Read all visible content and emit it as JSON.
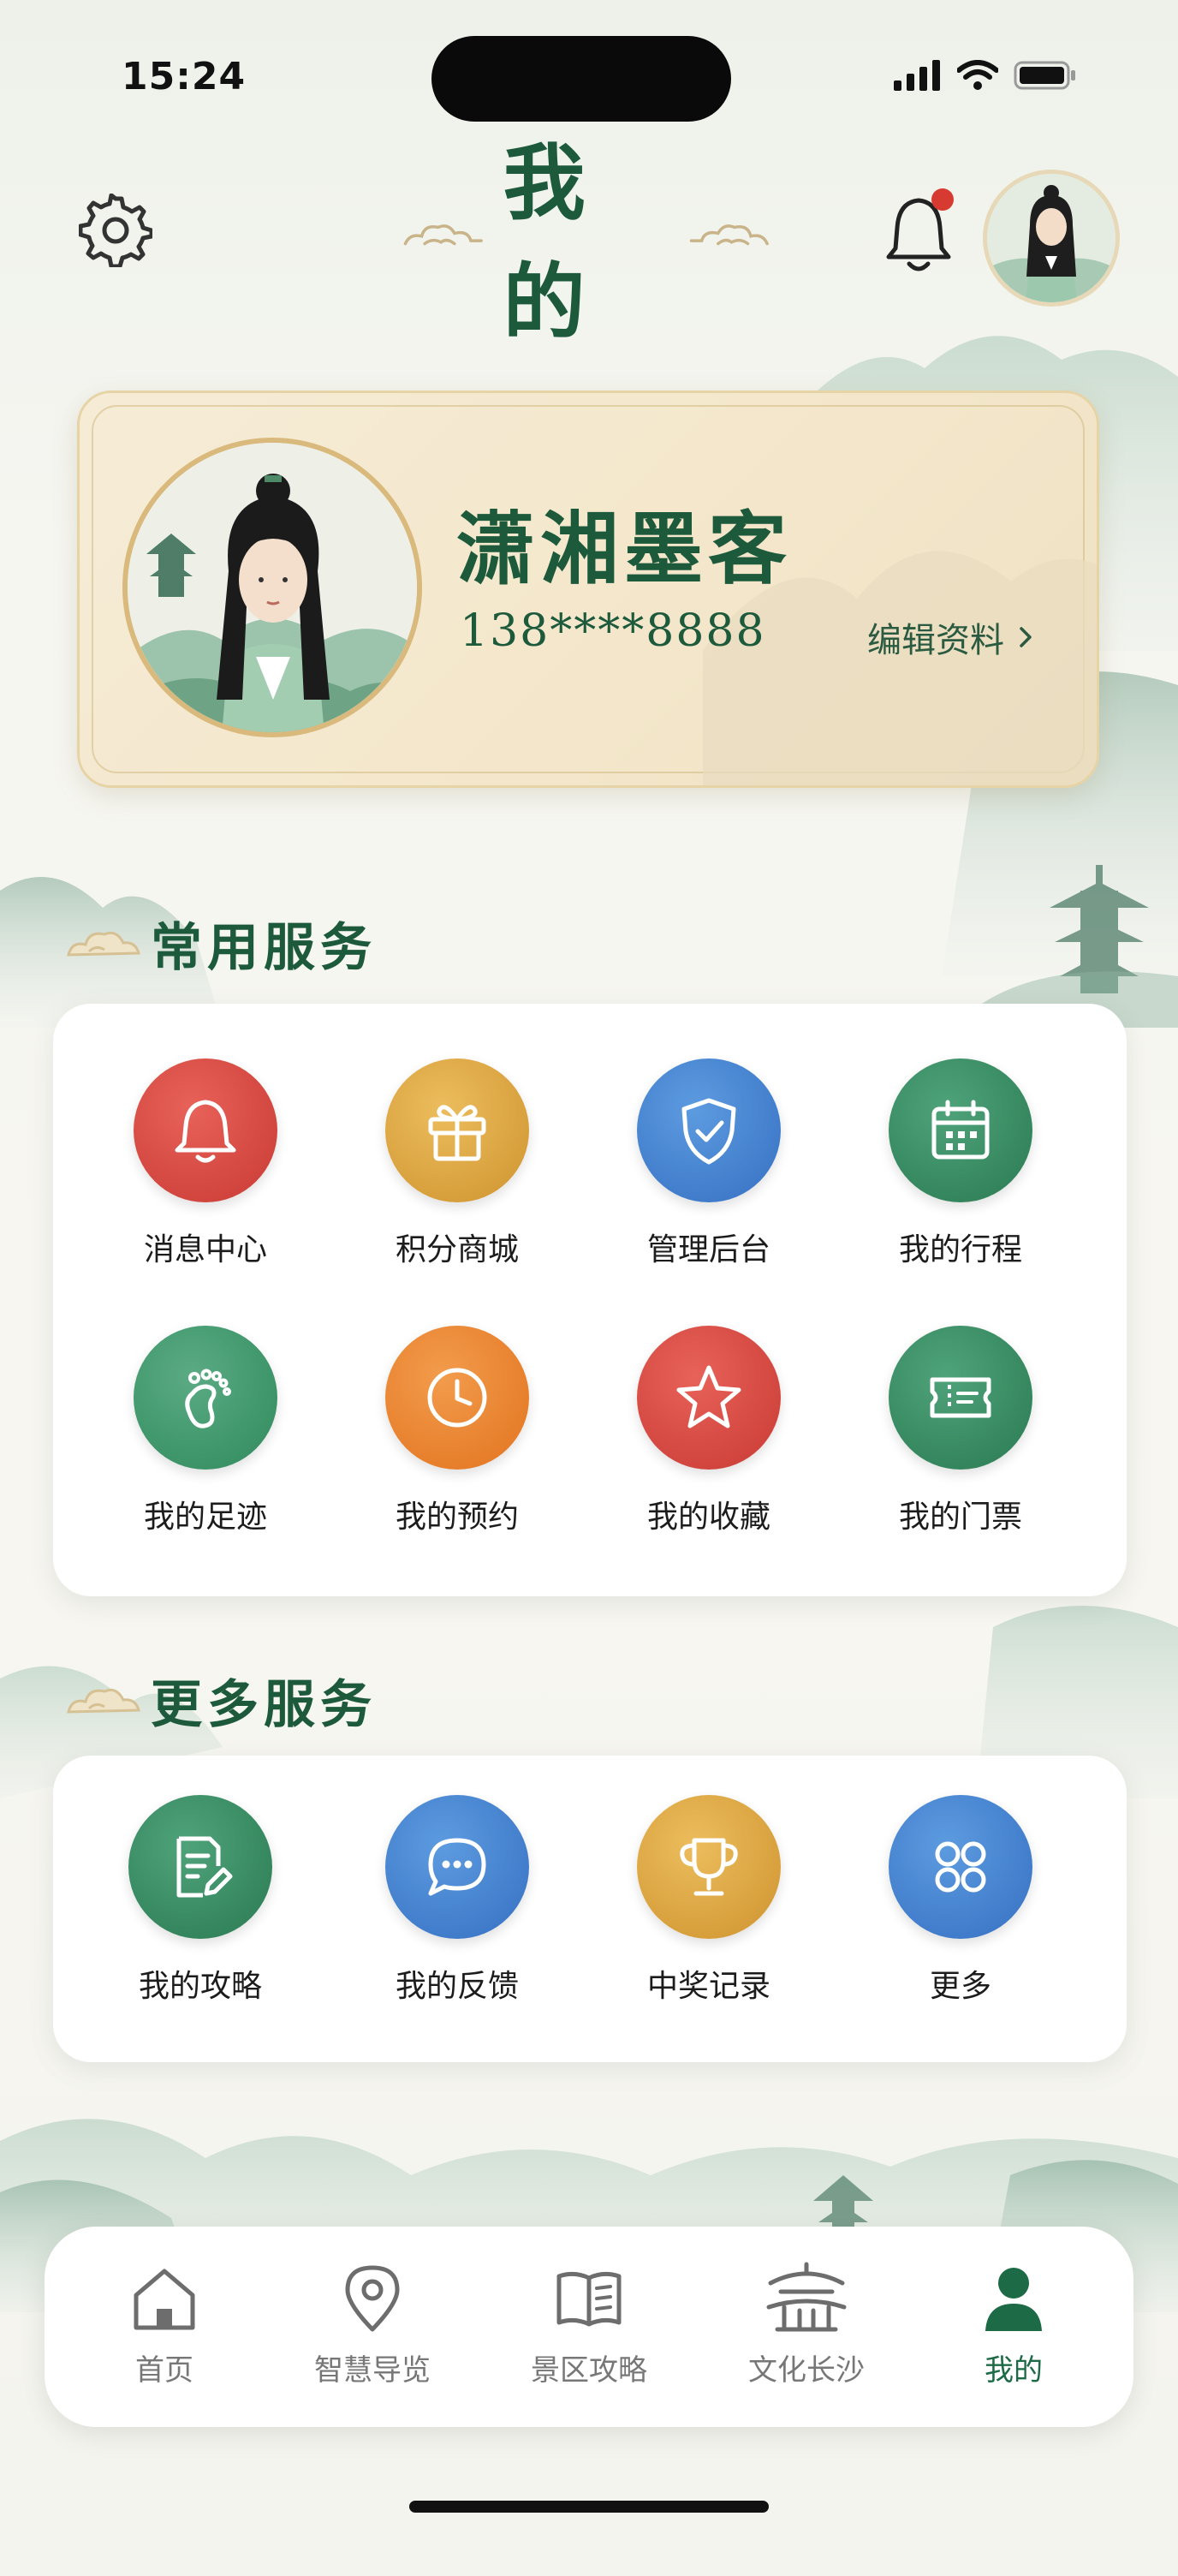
{
  "status_bar": {
    "time": "15:24"
  },
  "header": {
    "title": "我的"
  },
  "profile": {
    "name": "潇湘墨客",
    "phone": "138****8888",
    "edit_label": "编辑资料"
  },
  "common_services": {
    "title": "常用服务",
    "items": [
      {
        "label": "消息中心",
        "icon": "bell-icon",
        "color": "#d9473f"
      },
      {
        "label": "积分商城",
        "icon": "gift-icon",
        "color": "#d9a13c"
      },
      {
        "label": "管理后台",
        "icon": "shield-check-icon",
        "color": "#3f7fcf"
      },
      {
        "label": "我的行程",
        "icon": "calendar-icon",
        "color": "#2f8a5c"
      },
      {
        "label": "我的足迹",
        "icon": "footprint-icon",
        "color": "#3a9466"
      },
      {
        "label": "我的预约",
        "icon": "clock-icon",
        "color": "#e8802f"
      },
      {
        "label": "我的收藏",
        "icon": "star-icon",
        "color": "#d9473f"
      },
      {
        "label": "我的门票",
        "icon": "ticket-icon",
        "color": "#2f8a5c"
      }
    ]
  },
  "more_services": {
    "title": "更多服务",
    "items": [
      {
        "label": "我的攻略",
        "icon": "note-edit-icon",
        "color": "#2f8a5c"
      },
      {
        "label": "我的反馈",
        "icon": "chat-bubble-icon",
        "color": "#3f7fcf"
      },
      {
        "label": "中奖记录",
        "icon": "trophy-icon",
        "color": "#d9a13c"
      },
      {
        "label": "更多",
        "icon": "grid-icon",
        "color": "#3f7fcf"
      }
    ]
  },
  "tabbar": {
    "items": [
      {
        "label": "首页",
        "icon": "home-icon"
      },
      {
        "label": "智慧导览",
        "icon": "location-pin-icon"
      },
      {
        "label": "景区攻略",
        "icon": "book-icon"
      },
      {
        "label": "文化长沙",
        "icon": "pavilion-icon"
      },
      {
        "label": "我的",
        "icon": "person-icon",
        "active": true
      }
    ]
  },
  "colors": {
    "brand_green": "#1d5a3c",
    "active_tab": "#1d6a46",
    "notification_dot": "#d63a31"
  }
}
